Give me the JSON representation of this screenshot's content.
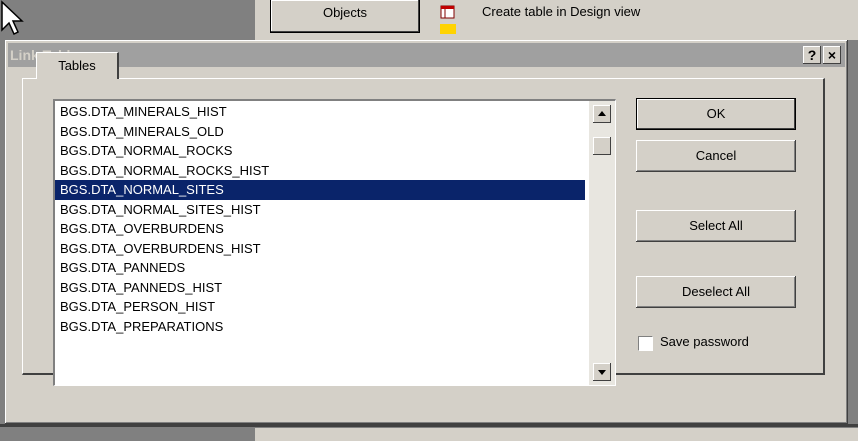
{
  "background": {
    "objects_label": "Objects",
    "create_table_text": "Create table in Design view"
  },
  "dialog": {
    "title": "Link Tables",
    "help_label": "?",
    "close_label": "×",
    "tab_label": "Tables",
    "list_items": [
      "BGS.DTA_MINERALS_HIST",
      "BGS.DTA_MINERALS_OLD",
      "BGS.DTA_NORMAL_ROCKS",
      "BGS.DTA_NORMAL_ROCKS_HIST",
      "BGS.DTA_NORMAL_SITES",
      "BGS.DTA_NORMAL_SITES_HIST",
      "BGS.DTA_OVERBURDENS",
      "BGS.DTA_OVERBURDENS_HIST",
      "BGS.DTA_PANNEDS",
      "BGS.DTA_PANNEDS_HIST",
      "BGS.DTA_PERSON_HIST",
      "BGS.DTA_PREPARATIONS"
    ],
    "selected_item": "BGS.DTA_NORMAL_SITES",
    "buttons": {
      "ok": "OK",
      "cancel": "Cancel",
      "select_all": "Select All",
      "deselect_all": "Deselect All"
    },
    "save_password_label": "Save password",
    "save_password_checked": false
  },
  "colors": {
    "selection": "#0a246a",
    "face": "#d4d0c8",
    "inactive_title": "#a0a0a0"
  }
}
